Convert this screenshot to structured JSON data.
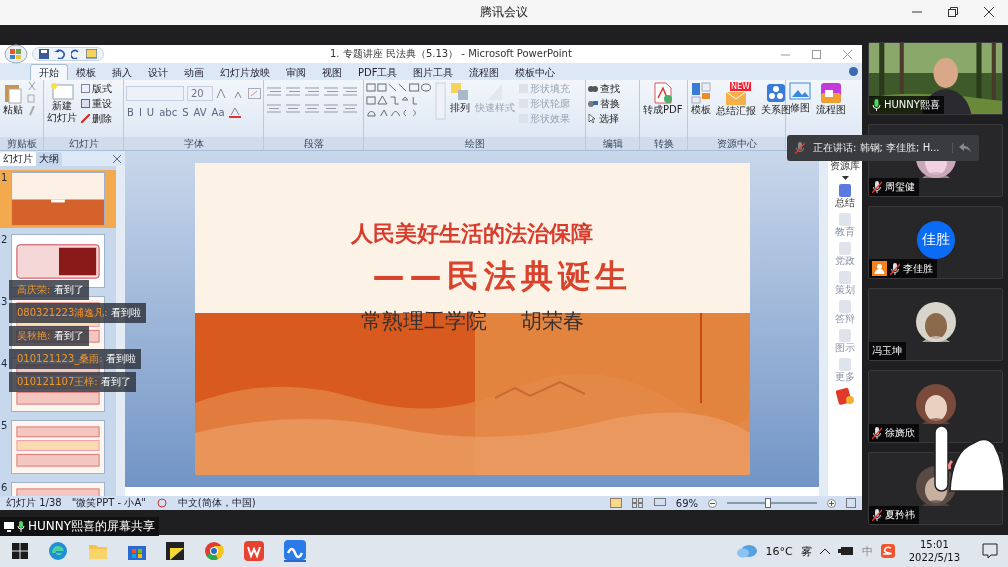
{
  "app_title": "腾讯会议",
  "ppt": {
    "title": "1. 专题讲座 民法典（5.13） - Microsoft PowerPoint",
    "tabs": [
      {
        "label": "开始",
        "selected": true
      },
      {
        "label": "模板",
        "selected": false
      },
      {
        "label": "插入",
        "selected": false
      },
      {
        "label": "设计",
        "selected": false
      },
      {
        "label": "动画",
        "selected": false
      },
      {
        "label": "幻灯片放映",
        "selected": false
      },
      {
        "label": "审阅",
        "selected": false
      },
      {
        "label": "视图",
        "selected": false
      },
      {
        "label": "PDF工具",
        "selected": false
      },
      {
        "label": "图片工具",
        "selected": false
      },
      {
        "label": "流程图",
        "selected": false
      },
      {
        "label": "模板中心",
        "selected": false
      }
    ],
    "ribbon": {
      "clipboard": {
        "paste": "粘贴",
        "label": "剪贴板"
      },
      "slides": {
        "new_slide": [
          "新建",
          "幻灯片"
        ],
        "layout": "版式",
        "reset": "重设",
        "delete": "删除",
        "label": "幻灯片"
      },
      "font": {
        "size": "20",
        "format_buttons": [
          "B",
          "I",
          "U",
          "abc",
          "S",
          "AV",
          "Aa"
        ],
        "label": "字体"
      },
      "paragraph": {
        "label": "段落"
      },
      "drawing": {
        "arrange": "排列",
        "quick_styles": {
          "label": "快速样式",
          "disabled": true
        },
        "shape_tools": [
          {
            "label": "形状填充",
            "disabled": true
          },
          {
            "label": "形状轮廓",
            "disabled": true
          },
          {
            "label": "形状效果",
            "disabled": true
          }
        ],
        "label": "绘图"
      },
      "editing": {
        "find": "查找",
        "replace": "替换",
        "select": "选择",
        "label": "编辑"
      },
      "convert": {
        "to_pdf": "转成PDF",
        "label": "转换"
      },
      "resources": {
        "template": "模板",
        "summary": "总结汇报",
        "badge": "NEW",
        "diagram": "关系图",
        "label": "资源中心"
      },
      "extra": {
        "retouch": "修图",
        "flowchart": "流程图"
      }
    },
    "panel_tabs": [
      {
        "label": "幻灯片",
        "selected": true
      },
      {
        "label": "大纲",
        "selected": false
      }
    ],
    "thumbnails": [
      {
        "number": "1",
        "selected": true
      },
      {
        "number": "2",
        "selected": false
      },
      {
        "number": "3",
        "selected": false
      },
      {
        "number": "4",
        "selected": false
      },
      {
        "number": "5",
        "selected": false
      },
      {
        "number": "6",
        "selected": false
      }
    ],
    "slide": {
      "title": "人民美好生活的法治保障",
      "subtitle": "——民法典诞生",
      "school": "常熟理工学院",
      "author": "胡荣春"
    },
    "resource_bar": {
      "title": "资源库",
      "items": [
        {
          "label": "总结",
          "disabled": false
        },
        {
          "label": "教育",
          "disabled": true
        },
        {
          "label": "党政",
          "disabled": true
        },
        {
          "label": "策划",
          "disabled": true
        },
        {
          "label": "答辩",
          "disabled": true
        },
        {
          "label": "图示",
          "disabled": true
        },
        {
          "label": "更多",
          "disabled": true
        }
      ]
    },
    "status": {
      "slide_counter": "幻灯片 1/38",
      "theme": "\"微笑PPT - 小A\"",
      "language": "中文(简体，中国)",
      "zoom": "69%",
      "zoom_slider": {
        "level": 0.45
      }
    }
  },
  "chat": [
    {
      "name": "高庆荣:",
      "text": "看到了"
    },
    {
      "name": "080321223浦逸凡:",
      "text": "看到啦"
    },
    {
      "name": "吴秋艳:",
      "text": "看到了"
    },
    {
      "name": "010121123_桑雨:",
      "text": "看到啦"
    },
    {
      "name": "010121107王梓:",
      "text": "看到了"
    }
  ],
  "share_label": "HUNNY熙喜的屏幕共享",
  "speaking": "正在讲话: 韩钢; 李佳胜; H...",
  "participants": [
    {
      "name": "HUNNY熙喜",
      "muted": false,
      "kind": "video",
      "host": false
    },
    {
      "name": "周玺健",
      "muted": true,
      "host": false
    },
    {
      "name": "李佳胜",
      "muted": true,
      "kind": "initials",
      "initials": "佳胜",
      "host": true
    },
    {
      "name": "冯玉坤",
      "host": false
    },
    {
      "name": "徐旖欣",
      "muted": true,
      "host": false
    },
    {
      "name": "夏矜祎",
      "muted": true,
      "host": false
    }
  ],
  "taskbar": {
    "temperature": "16°C",
    "weather": "雾",
    "ime": "中",
    "time": "15:01",
    "date": "2022/5/13"
  }
}
